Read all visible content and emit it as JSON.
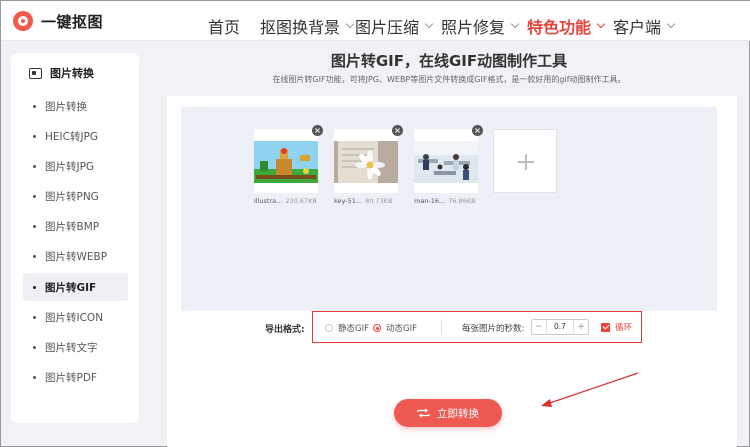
{
  "app": {
    "name": "一键抠图"
  },
  "nav": {
    "items": [
      {
        "label": "首页",
        "has_dropdown": false,
        "active": false
      },
      {
        "label": "抠图换背景",
        "has_dropdown": true,
        "active": false
      },
      {
        "label": "图片压缩",
        "has_dropdown": true,
        "active": false
      },
      {
        "label": "照片修复",
        "has_dropdown": true,
        "active": false
      },
      {
        "label": "特色功能",
        "has_dropdown": true,
        "active": true
      },
      {
        "label": "客户端",
        "has_dropdown": true,
        "active": false
      }
    ]
  },
  "sidebar": {
    "header": "图片转换",
    "items": [
      {
        "label": "图片转换",
        "active": false
      },
      {
        "label": "HEIC转JPG",
        "active": false
      },
      {
        "label": "图片转JPG",
        "active": false
      },
      {
        "label": "图片转PNG",
        "active": false
      },
      {
        "label": "图片转BMP",
        "active": false
      },
      {
        "label": "图片转WEBP",
        "active": false
      },
      {
        "label": "图片转GIF",
        "active": true
      },
      {
        "label": "图片转ICON",
        "active": false
      },
      {
        "label": "图片转文字",
        "active": false
      },
      {
        "label": "图片转PDF",
        "active": false
      }
    ]
  },
  "main": {
    "title": "图片转GIF，在线GIF动图制作工具",
    "subtitle": "在线图片转GIF功能，可将JPG、WEBP等图片文件转换成GIF格式，是一款好用的gif动图制作工具。"
  },
  "files": [
    {
      "name": "illustra...",
      "size": "230.67KB"
    },
    {
      "name": "key-51...",
      "size": "80.73KB"
    },
    {
      "name": "man-16...",
      "size": "76.86KB"
    }
  ],
  "export": {
    "label": "导出格式:",
    "options": [
      {
        "label": "静态GIF",
        "selected": false
      },
      {
        "label": "动态GIF",
        "selected": true
      }
    ],
    "seconds_label": "每张图片的秒数:",
    "seconds_value": "0.7",
    "decrement": "−",
    "increment": "+",
    "loop_label": "循环",
    "loop_checked": true
  },
  "convert_button": {
    "label": "立即转换"
  },
  "colors": {
    "accent": "#e8453c",
    "button": "#ee5a52",
    "annotation": "#d93030"
  }
}
